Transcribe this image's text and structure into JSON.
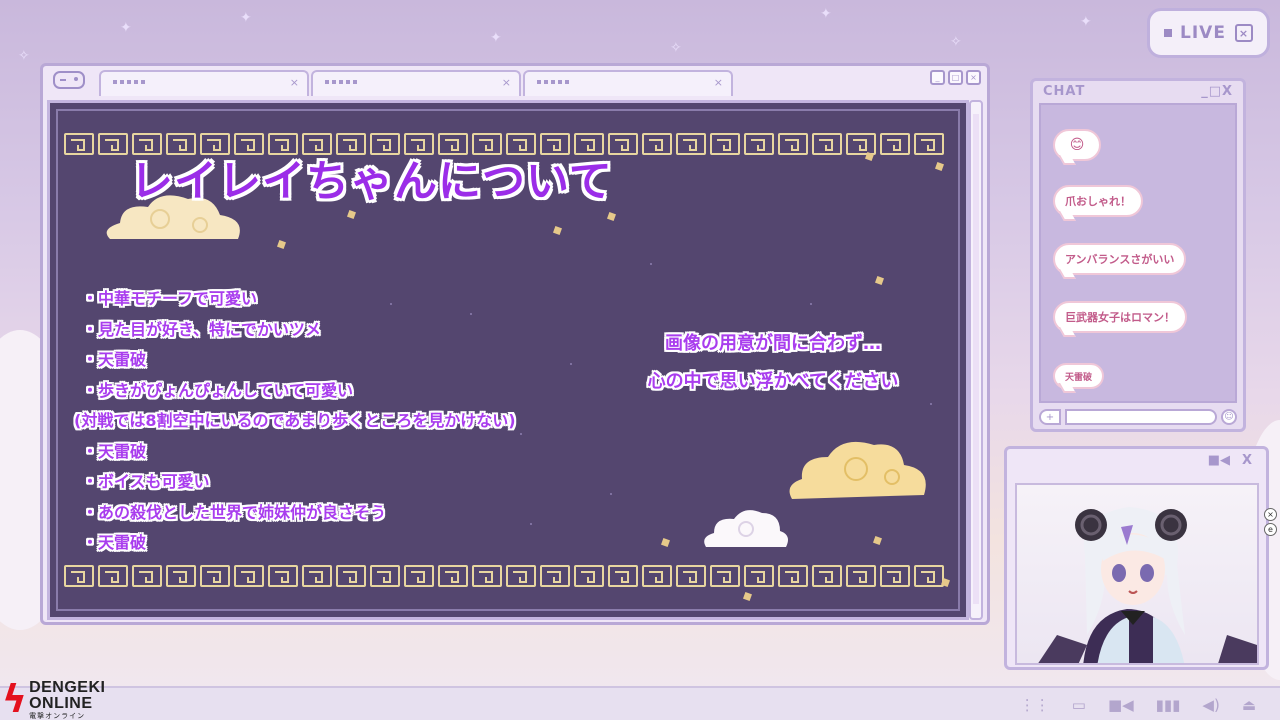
{
  "live_badge": {
    "label": "LIVE",
    "close_glyph": "×"
  },
  "main_window": {
    "tabs": [
      {
        "close_glyph": "×"
      },
      {
        "close_glyph": "×"
      },
      {
        "close_glyph": "×"
      }
    ],
    "controls": {
      "minimize": "_",
      "maximize": "□",
      "close": "×"
    },
    "panel": {
      "title": "レイレイちゃんについて",
      "bullets": [
        "・中華モチーフで可愛い",
        "・見た目が好き、特にでかいツメ",
        "・天雷破",
        "・歩きがぴょんぴょんしていて可愛い",
        "(対戦では8割空中にいるのであまり歩くところを見かけない)",
        "・天雷破",
        "・ボイスも可愛い",
        "・あの殺伐とした世界で姉妹仲が良さそう",
        "・天雷破"
      ],
      "notice": [
        "画像の用意が間に合わず…",
        "心の中で思い浮かべてください"
      ]
    }
  },
  "chat_window": {
    "title": "CHAT",
    "controls": "_□X",
    "messages": [
      {
        "text": "😊"
      },
      {
        "text": "爪おしゃれ！"
      },
      {
        "text": "アンバランスさがいい"
      },
      {
        "text": "巨武器女子はロマン！"
      },
      {
        "text": "天雷破"
      }
    ],
    "input": {
      "plus_glyph": "+",
      "emoji_glyph": "☺"
    }
  },
  "camera_window": {
    "controls": [
      "■◀",
      "X"
    ]
  },
  "taskbar": {
    "icons": [
      "⋮⋮",
      "▭",
      "■◀",
      "▮▮▮",
      "◀)",
      "⏏"
    ]
  },
  "logo": {
    "line1": "DENGEKI",
    "line2": "ONLINE",
    "line3": "電撃オンライン"
  },
  "side_icons": [
    "×",
    "e"
  ],
  "colors": {
    "accent_purple": "#a93dee",
    "panel_bg": "#54466f",
    "frame": "#c2b3de",
    "gold": "#e8d6a0"
  }
}
